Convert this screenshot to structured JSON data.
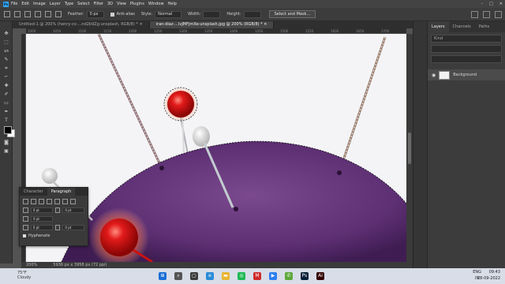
{
  "app": {
    "logo": "Ps"
  },
  "menubar": {
    "items": [
      "File",
      "Edit",
      "Image",
      "Layer",
      "Type",
      "Select",
      "Filter",
      "3D",
      "View",
      "Plugins",
      "Window",
      "Help"
    ],
    "win_controls": [
      "–",
      "□",
      "✕"
    ]
  },
  "options": {
    "feather_label": "Feather:",
    "feather_value": "0 px",
    "antialias_label": "Anti-alias",
    "style_label": "Style:",
    "style_value": "Normal",
    "width_label": "Width:",
    "height_label": "Height:",
    "select_mask_label": "Select and Mask..."
  },
  "tabs": [
    {
      "label": "Untitled-1 @ 200% (henry-co-...nd2b9Zg-unsplash, RGB/8) *  ✕"
    },
    {
      "label": "iran-dlaz-...lvJMFjmXe-unsplash.jpg @ 200% (RGB/8) *  ✕"
    }
  ],
  "ruler": {
    "ticks": [
      "1000",
      "1050",
      "1100",
      "1150",
      "1200",
      "1250",
      "1300",
      "1350",
      "1400",
      "1450",
      "1500",
      "1550",
      "1600",
      "1650",
      "1700"
    ]
  },
  "status": {
    "zoom": "200%",
    "doc": "5936 px x 3958 px (72 ppi)"
  },
  "panel": {
    "tabs": [
      "Layers",
      "Channels",
      "Paths"
    ],
    "kind_label": "Kind",
    "layer_name": "Background"
  },
  "paragraph_panel": {
    "tabs": [
      "Character",
      "Paragraph"
    ],
    "fields": [
      "0 pt",
      "0 pt",
      "0 pt",
      "0 pt",
      "0 pt"
    ],
    "hyphenate_label": "Hyphenate"
  },
  "taskbar": {
    "weather_temp": "75°F",
    "weather_desc": "Cloudy",
    "lang": "ENG",
    "region": "IN",
    "time": "09:43",
    "date": "28-09-2022"
  }
}
